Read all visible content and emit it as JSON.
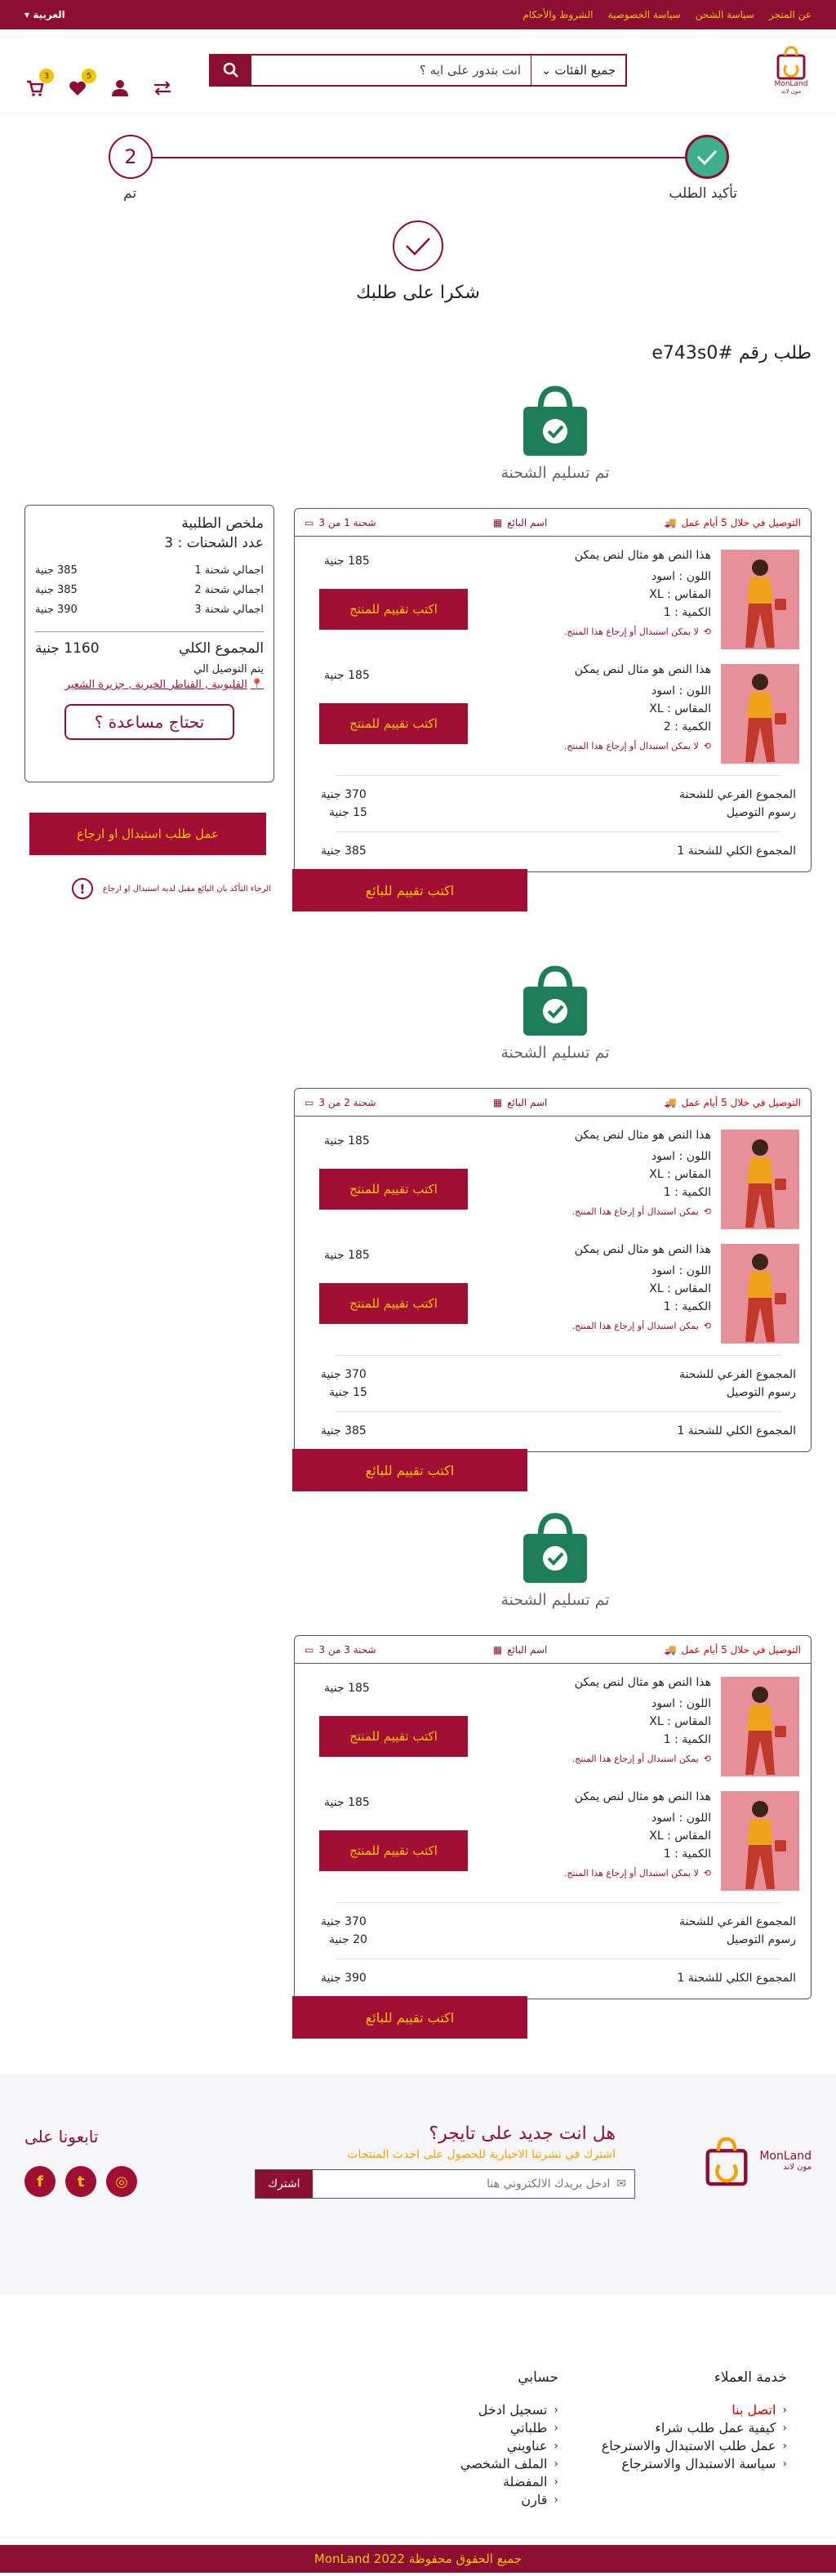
{
  "topbar": {
    "links": [
      "عن المتجر",
      "سياسة الشحن",
      "سياسة الخصوصية",
      "الشروط والأحكام"
    ],
    "language": "العربية"
  },
  "header": {
    "logo_text": "MonLand",
    "logo_sub": "مون لاند",
    "search_placeholder": "انت بتدور على ايه ؟",
    "category_label": "جميع الفئات",
    "cart_count": "3",
    "wishlist_count": "5"
  },
  "stepper": {
    "step_done_label": "تأكيد الطلب",
    "step_current_number": "2",
    "step_current_label": "تم"
  },
  "thanks": "شكرا على طلبك",
  "order": "طلب رقم #e743s0",
  "summary": {
    "title": "ملخص الطلبية",
    "count_label": "عدد الشحنات : 3",
    "lines": [
      {
        "label": "اجمالي شحنة 1",
        "value": "385 جنية"
      },
      {
        "label": "اجمالي شحنة 2",
        "value": "385 جنية"
      },
      {
        "label": "اجمالي شحنة 3",
        "value": "390 جنية"
      }
    ],
    "total_label": "المجموع الكلي",
    "total_value": "1160 جنية",
    "deliver_to": "يتم التوصيل الي",
    "address": "القليوبية , القناطر الخيرية , جزيرة الشعير",
    "help": "تحتاج مساعدة ؟"
  },
  "return_button": "عمل طلب استبدال او ارجاع",
  "warning": "الرجاء التأكد بان البائع مقبل لديه استبدال او ارجاع",
  "shipments": [
    {
      "status": "تم تسليم الشحنة",
      "header": "شحنة 1 من 3",
      "seller": "اسم البائع",
      "delivery": "التوصيل في خلال 5 أيام عمل",
      "items": [
        {
          "title": "هذا النص هو مثال لنص يمكن",
          "color": "اللون : اسود",
          "size": "المقاس : XL",
          "qty": "الكمية : 1",
          "note": "لا يمكن استبدال أو إرجاع هذا المنتج.",
          "price": "185 جنية",
          "rate": "اكتب تقييم للمنتج"
        },
        {
          "title": "هذا النص هو مثال لنص يمكن",
          "color": "اللون : اسود",
          "size": "المقاس : XL",
          "qty": "الكمية : 2",
          "note": "لا يمكن استبدال أو إرجاع هذا المنتج.",
          "price": "185 جنية",
          "rate": "اكتب تقييم للمنتج"
        }
      ],
      "subtotal_label": "المجموع الفرعي للشحنة",
      "subtotal": "370 جنية",
      "shipping_label": "رسوم التوصيل",
      "shipping": "15 جنية",
      "total_label": "المجموع الكلي للشحنة 1",
      "total": "385 جنية",
      "seller_rate": "اكتب تقييم للبائع"
    },
    {
      "status": "تم تسليم الشحنة",
      "header": "شحنة 2 من 3",
      "seller": "اسم البائع",
      "delivery": "التوصيل في خلال 5 أيام عمل",
      "items": [
        {
          "title": "هذا النص هو مثال لنص يمكن",
          "color": "اللون : اسود",
          "size": "المقاس : XL",
          "qty": "الكمية : 1",
          "note": "يمكن استبدال أو إرجاع هذا المنتج.",
          "price": "185 جنية",
          "rate": "اكتب تقييم للمنتج"
        },
        {
          "title": "هذا النص هو مثال لنص يمكن",
          "color": "اللون : اسود",
          "size": "المقاس : XL",
          "qty": "الكمية : 1",
          "note": "يمكن استبدال أو إرجاع هذا المنتج.",
          "price": "185 جنية",
          "rate": "اكتب تقييم للمنتج"
        }
      ],
      "subtotal_label": "المجموع الفرعي للشحنة",
      "subtotal": "370 جنية",
      "shipping_label": "رسوم التوصيل",
      "shipping": "15 جنية",
      "total_label": "المجموع الكلي للشحنة 1",
      "total": "385 جنية",
      "seller_rate": "اكتب تقييم للبائع"
    },
    {
      "status": "تم تسليم الشحنة",
      "header": "شحنة 3 من 3",
      "seller": "اسم البائع",
      "delivery": "التوصيل في خلال 5 أيام عمل",
      "items": [
        {
          "title": "هذا النص هو مثال لنص يمكن",
          "color": "اللون : اسود",
          "size": "المقاس : XL",
          "qty": "الكمية : 1",
          "note": "يمكن استبدال أو إرجاع هذا المنتج.",
          "price": "185 جنية",
          "rate": "اكتب تقييم للمنتج"
        },
        {
          "title": "هذا النص هو مثال لنص يمكن",
          "color": "اللون : اسود",
          "size": "المقاس : XL",
          "qty": "الكمية : 1",
          "note": "لا يمكن استبدال أو إرجاع هذا المنتج.",
          "price": "185 جنية",
          "rate": "اكتب تقييم للمنتج"
        }
      ],
      "subtotal_label": "المجموع الفرعي للشحنة",
      "subtotal": "370 جنية",
      "shipping_label": "رسوم التوصيل",
      "shipping": "20 جنية",
      "total_label": "المجموع الكلي للشحنة 1",
      "total": "390 جنية",
      "seller_rate": "اكتب تقييم للبائع"
    }
  ],
  "newsletter": {
    "question": "هل انت جديد على تايجر؟",
    "subtitle": "اشترك في نشرتنا الاخبارية للحصول على احدث المنتجات",
    "placeholder": "ادخل بريدك الالكتروني هنا",
    "button": "اشترك",
    "follow": "تابعونا على"
  },
  "footer": {
    "customer_service": "خدمة العملاء",
    "cs_items": [
      "اتصل بنا",
      "كيفية عمل طلب شراء",
      "عمل طلب الاستبدال والاسترجاع",
      "سياسة الاستبدال والاسترجاع"
    ],
    "account": "حسابي",
    "account_items": [
      "تسجيل  ادخل",
      "طلباتي",
      "عناويني",
      "الملف الشخصي",
      "المفضلة",
      "قارن"
    ],
    "copyright": "جميع الحقوق محفوظة  MonLand 2022"
  },
  "colors": {
    "brand": "#8c0f33",
    "accent": "#f3c300",
    "success": "#1e7d5a"
  }
}
